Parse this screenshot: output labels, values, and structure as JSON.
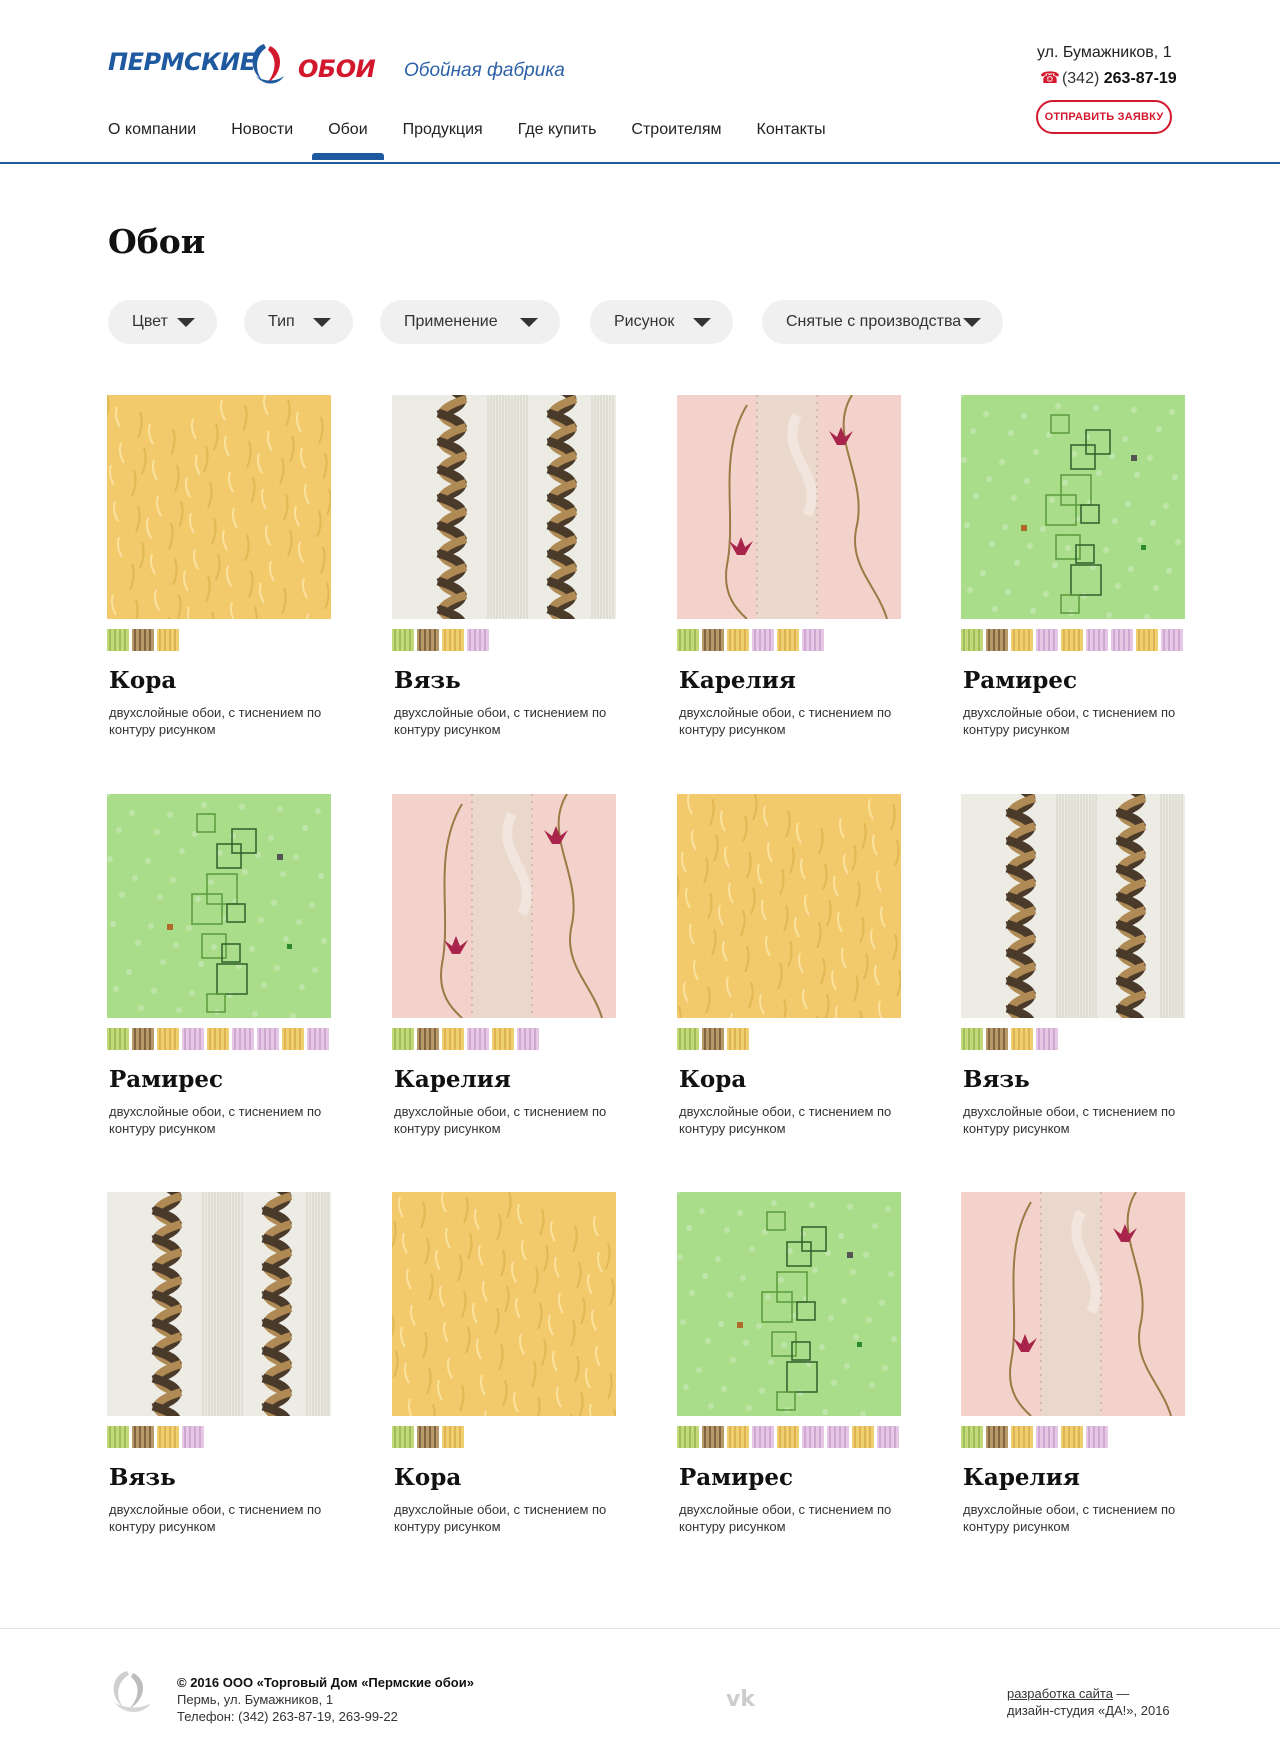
{
  "header": {
    "logo_word1": "ПЕРМСКИЕ",
    "logo_word2": "ОБОИ",
    "tagline": "Обойная фабрика",
    "address": "ул. Бумажников, 1",
    "phone_code": "(342)",
    "phone_number": "263-87-19",
    "cta": "ОТПРАВИТЬ ЗАЯВКУ",
    "nav": [
      "О компании",
      "Новости",
      "Обои",
      "Продукция",
      "Где купить",
      "Строителям",
      "Контакты"
    ],
    "active_nav": "Обои"
  },
  "page_title": "Обои",
  "filters": [
    "Цвет",
    "Тип",
    "Применение",
    "Рисунок",
    "Снятые с производства"
  ],
  "cards": [
    {
      "title": "Кора",
      "desc": "двухслойные обои, с тиснением по контуру рисунком",
      "pattern": "gold",
      "chips": [
        "green",
        "brown",
        "gold"
      ]
    },
    {
      "title": "Вязь",
      "desc": "двухслойные обои, с тиснением по контуру рисунком",
      "pattern": "braid",
      "chips": [
        "green",
        "brown",
        "gold",
        "pink"
      ]
    },
    {
      "title": "Карелия",
      "desc": "двухслойные обои, с тиснением по контуру рисунком",
      "pattern": "floral",
      "chips": [
        "green",
        "brown",
        "gold",
        "pink",
        "gold",
        "pink"
      ]
    },
    {
      "title": "Рамирес",
      "desc": "двухслойные обои, с тиснением по контуру рисунком",
      "pattern": "green",
      "chips": [
        "green",
        "brown",
        "gold",
        "pink",
        "gold",
        "pink",
        "pink",
        "gold",
        "pink"
      ]
    },
    {
      "title": "Рамирес",
      "desc": "двухслойные обои, с тиснением по контуру рисунком",
      "pattern": "green",
      "chips": [
        "green",
        "brown",
        "gold",
        "pink",
        "gold",
        "pink",
        "pink",
        "gold",
        "pink"
      ]
    },
    {
      "title": "Карелия",
      "desc": "двухслойные обои, с тиснением по контуру рисунком",
      "pattern": "floral",
      "chips": [
        "green",
        "brown",
        "gold",
        "pink",
        "gold",
        "pink"
      ]
    },
    {
      "title": "Кора",
      "desc": "двухслойные обои, с тиснением по контуру рисунком",
      "pattern": "gold",
      "chips": [
        "green",
        "brown",
        "gold"
      ]
    },
    {
      "title": "Вязь",
      "desc": "двухслойные обои, с тиснением по контуру рисунком",
      "pattern": "braid",
      "chips": [
        "green",
        "brown",
        "gold",
        "pink"
      ]
    },
    {
      "title": "Вязь",
      "desc": "двухслойные обои, с тиснением по контуру рисунком",
      "pattern": "braid",
      "chips": [
        "green",
        "brown",
        "gold",
        "pink"
      ]
    },
    {
      "title": "Кора",
      "desc": "двухслойные обои, с тиснением по контуру рисунком",
      "pattern": "gold",
      "chips": [
        "green",
        "brown",
        "gold"
      ]
    },
    {
      "title": "Рамирес",
      "desc": "двухслойные обои, с тиснением по контуру рисунком",
      "pattern": "green",
      "chips": [
        "green",
        "brown",
        "gold",
        "pink",
        "gold",
        "pink",
        "pink",
        "gold",
        "pink"
      ]
    },
    {
      "title": "Карелия",
      "desc": "двухслойные обои, с тиснением по контуру рисунком",
      "pattern": "floral",
      "chips": [
        "green",
        "brown",
        "gold",
        "pink",
        "gold",
        "pink"
      ]
    }
  ],
  "footer": {
    "copyright": "© 2016 ООО «Торговый Дом «Пермские обои»",
    "city_address": "Пермь, ул. Бумажников, 1",
    "phones": "Телефон: (342) 263-87-19, 263-99-22",
    "social_icon": "vk-icon",
    "dev_link": "разработка сайта",
    "dev_sep": " —",
    "dev_studio": "дизайн-студия «ДА!», 2016"
  },
  "colors": {
    "brand_blue": "#1f5aa0",
    "brand_red": "#d3182e"
  }
}
